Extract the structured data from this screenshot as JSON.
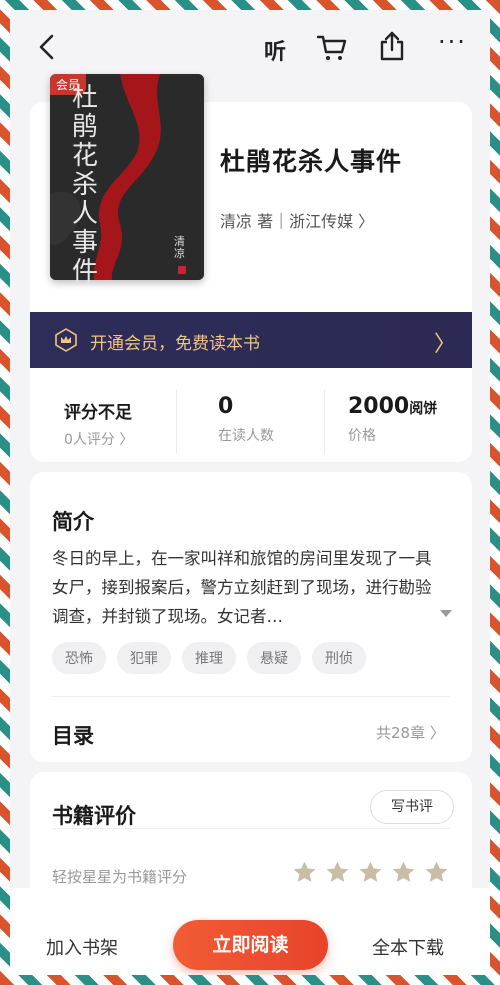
{
  "topbar": {
    "listen_label": "听",
    "more_label": "···"
  },
  "book": {
    "vip_tag": "会员",
    "cover_title": "杜鹃花杀人事件",
    "cover_author": "清凉",
    "title": "杜鹃花杀人事件",
    "meta": "清凉 著｜浙江传媒 〉"
  },
  "vip_banner": {
    "text": "开通会员，免费读本书",
    "chevron": "〉"
  },
  "stats": {
    "rating": {
      "value": "评分不足",
      "label": "0人评分 〉"
    },
    "readers": {
      "value": "0",
      "label": "在读人数"
    },
    "price": {
      "value": "2000",
      "unit": "阅饼",
      "label": "价格"
    }
  },
  "intro": {
    "title": "简介",
    "text": "冬日的早上，在一家叫祥和旅馆的房间里发现了一具女尸，接到报案后，警方立刻赶到了现场，进行勘验调查，并封锁了现场。女记者…",
    "tags": [
      "恐怖",
      "犯罪",
      "推理",
      "悬疑",
      "刑侦"
    ]
  },
  "toc": {
    "title": "目录",
    "count": "共28章 〉"
  },
  "review": {
    "title": "书籍评价",
    "write_label": "写书评",
    "hint": "轻按星星为书籍评分",
    "star_color": "#c9bda5"
  },
  "bottom": {
    "shelf_label": "加入书架",
    "read_label": "立即阅读",
    "download_label": "全本下载"
  }
}
